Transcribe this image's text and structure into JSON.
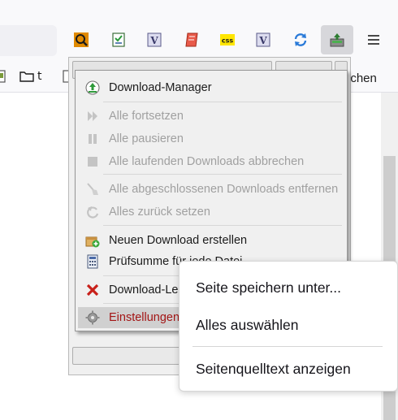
{
  "toolbar": {
    "icons": [
      {
        "name": "search-magnifier-icon"
      },
      {
        "name": "checklist-icon"
      },
      {
        "name": "vim-v-icon"
      },
      {
        "name": "scroll-red-icon"
      },
      {
        "name": "css-icon",
        "label": "css"
      },
      {
        "name": "vim-v-icon-2"
      },
      {
        "name": "sync-arrows-icon"
      },
      {
        "name": "download-manager-icon"
      }
    ],
    "menu_icon": "hamburger-menu-icon"
  },
  "bookmarks": {
    "item_t": "t",
    "right_text": "ichen"
  },
  "addon_menu": {
    "items": [
      {
        "label": "Download-Manager",
        "icon": "download-manager-icon"
      },
      {
        "label": "Alle fortsetzen",
        "icon": "resume-icon"
      },
      {
        "label": "Alle pausieren",
        "icon": "pause-icon"
      },
      {
        "label": "Alle laufenden Downloads abbrechen",
        "icon": "stop-icon"
      },
      {
        "label": "Alle abgeschlossenen Downloads entfernen",
        "icon": "broom-icon"
      },
      {
        "label": "Alles zurück setzen",
        "icon": "reset-icon"
      },
      {
        "label": "Neuen Download erstellen",
        "icon": "new-download-icon"
      },
      {
        "label": "Prüfsumme für jede Datei",
        "icon": "checksum-icon"
      },
      {
        "label": "Download-Leiste",
        "icon": "close-x-icon"
      },
      {
        "label": "Einstellungen...",
        "icon": "gear-icon"
      }
    ]
  },
  "page_menu": {
    "items": [
      {
        "label": "Seite speichern unter..."
      },
      {
        "label": "Alles auswählen"
      },
      {
        "label": "Seitenquelltext anzeigen"
      }
    ]
  },
  "colors": {
    "menu_bg": "#f0f0f0",
    "disabled_text": "#a0a0a0",
    "danger_text": "#a31515",
    "highlight": "#d0d0d0"
  }
}
